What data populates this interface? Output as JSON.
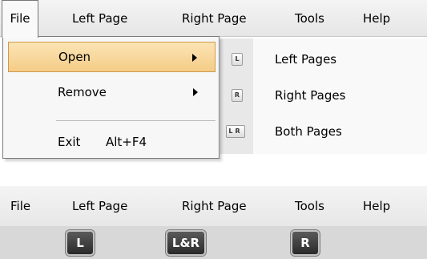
{
  "menubar": {
    "items": [
      {
        "label": "File"
      },
      {
        "label": "Left Page"
      },
      {
        "label": "Right Page"
      },
      {
        "label": "Tools"
      },
      {
        "label": "Help"
      }
    ]
  },
  "file_menu": {
    "items": [
      {
        "label": "Open",
        "has_submenu": true,
        "highlighted": true
      },
      {
        "label": "Remove",
        "has_submenu": true
      },
      {
        "label": "Exit",
        "shortcut": "Alt+F4"
      }
    ]
  },
  "open_submenu": {
    "items": [
      {
        "label": "Left Pages",
        "icon": "L"
      },
      {
        "label": "Right Pages",
        "icon": "R"
      },
      {
        "label": "Both Pages",
        "icon": "LR"
      }
    ]
  },
  "menubar2": {
    "items": [
      {
        "label": "File"
      },
      {
        "label": "Left Page"
      },
      {
        "label": "Right Page"
      },
      {
        "label": "Tools"
      },
      {
        "label": "Help"
      }
    ]
  },
  "toolbar": {
    "buttons": [
      {
        "label": "L"
      },
      {
        "label": "L&R"
      },
      {
        "label": "R"
      }
    ]
  },
  "colors": {
    "highlight_fill": "#f5cc87",
    "highlight_border": "#cf9a4e",
    "toolbar_button": "#2a2a2a"
  }
}
